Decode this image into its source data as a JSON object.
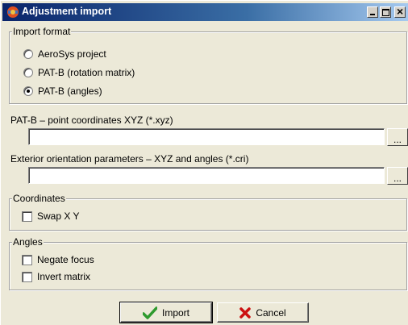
{
  "window": {
    "title": "Adjustment import"
  },
  "import_format": {
    "legend": "Import format",
    "options": [
      {
        "label": "AeroSys project",
        "selected": false
      },
      {
        "label": "PAT-B (rotation matrix)",
        "selected": false
      },
      {
        "label": "PAT-B (angles)",
        "selected": true
      }
    ]
  },
  "patb_points": {
    "label": "PAT-B – point coordinates XYZ (*.xyz)",
    "value": "",
    "browse_label": "..."
  },
  "exterior_orientation": {
    "label": "Exterior orientation parameters – XYZ and angles (*.cri)",
    "value": "",
    "browse_label": "..."
  },
  "coordinates": {
    "legend": "Coordinates",
    "swap_xy": {
      "label": "Swap X Y",
      "checked": false
    }
  },
  "angles": {
    "legend": "Angles",
    "negate_focus": {
      "label": "Negate focus",
      "checked": false
    },
    "invert_matrix": {
      "label": "Invert matrix",
      "checked": false
    }
  },
  "buttons": {
    "import_label": "Import",
    "cancel_label": "Cancel"
  },
  "colors": {
    "title_bar": "#0a246a",
    "checkmark": "#2e9a2e",
    "cancel_x": "#cc1010"
  }
}
